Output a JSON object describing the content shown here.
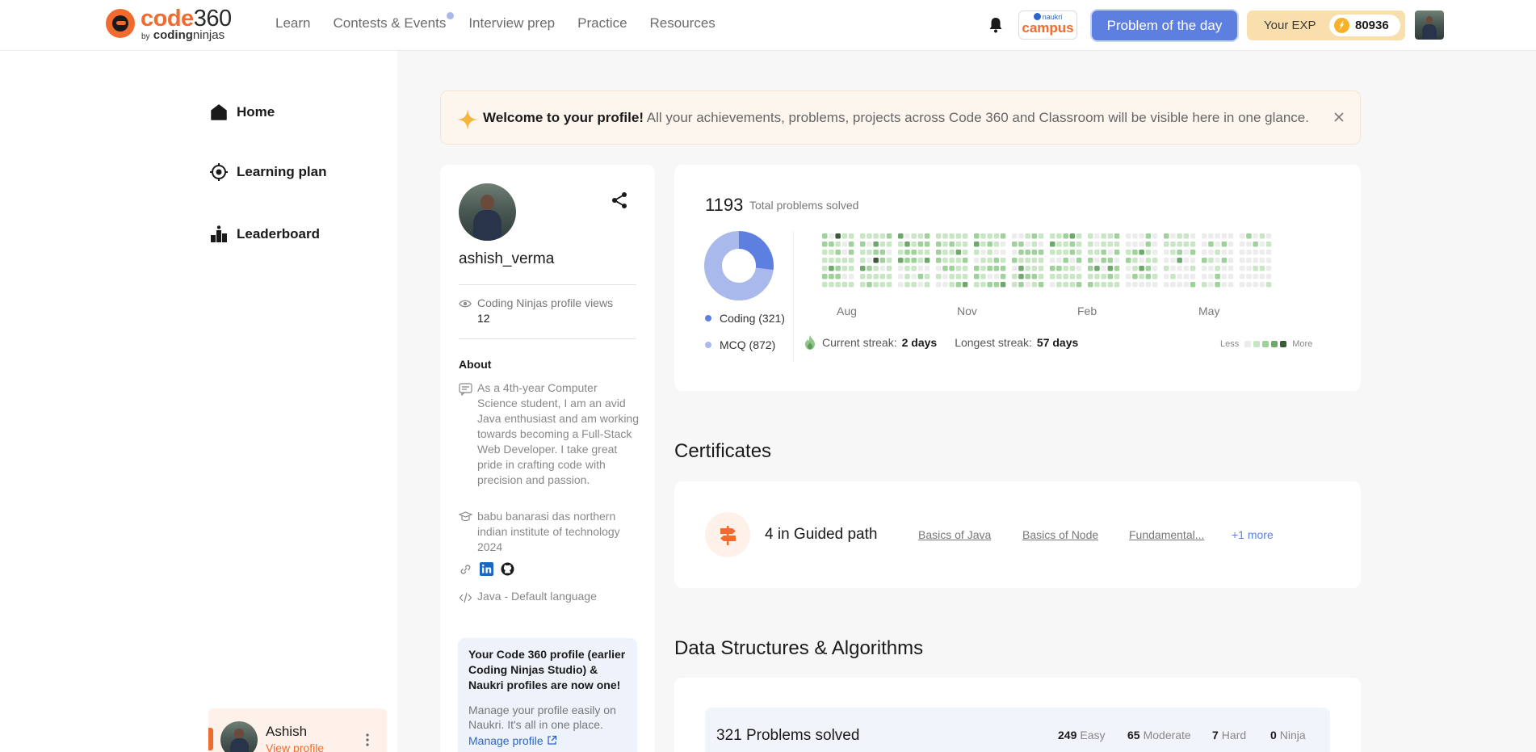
{
  "nav": {
    "logo_word": "code",
    "logo_num": "360",
    "logo_by": "by",
    "logo_brand_bold": "coding",
    "logo_brand_rest": "ninjas",
    "links": [
      "Learn",
      "Contests & Events",
      "Interview prep",
      "Practice",
      "Resources"
    ],
    "campus_top": "naukri",
    "campus_main": "campus",
    "potd_label": "Problem of the day",
    "exp_label": "Your EXP",
    "exp_value": "80936"
  },
  "sidebar": {
    "items": [
      {
        "label": "Home",
        "icon": "home-icon"
      },
      {
        "label": "Learning plan",
        "icon": "target-icon"
      },
      {
        "label": "Leaderboard",
        "icon": "leaderboard-icon"
      }
    ],
    "user_name": "Ashish",
    "user_link": "View profile"
  },
  "welcome": {
    "bold": "Welcome to your profile!",
    "text": " All your achievements, problems, projects across Code 360 and Classroom will be visible here in one glance."
  },
  "profile": {
    "username": "ashish_verma",
    "views_label": "Coding Ninjas profile views",
    "views_value": "12",
    "about_label": "About",
    "bio": "As a 4th-year Computer Science student, I am an avid Java enthusiast and am working towards becoming a Full-Stack Web Developer. I take great pride in crafting code with precision and passion.",
    "college": "babu banarasi das northern indian institute of technology 2024",
    "language": "Java - Default language",
    "notice_title": "Your Code 360 profile (earlier Coding Ninjas Studio) & Naukri profiles are now one!",
    "notice_desc": "Manage your profile easily on Naukri. It's all in one place.",
    "notice_link": "Manage profile"
  },
  "stats": {
    "total": "1193",
    "total_label": "Total problems solved",
    "coding_label": "Coding (321)",
    "mcq_label": "MCQ (872)",
    "coding_value": 321,
    "mcq_value": 872,
    "months": [
      "Aug",
      "Nov",
      "Feb",
      "May"
    ],
    "current_streak_label": "Current streak:",
    "current_streak": "2 days",
    "longest_streak_label": "Longest streak:",
    "longest_streak": "57 days",
    "legend_less": "Less",
    "legend_more": "More",
    "colors": {
      "coding": "#5d7fe0",
      "mcq": "#a9b9ec",
      "heat_levels": [
        "#ececec",
        "#c8e6c3",
        "#9fd19a",
        "#6fa86b",
        "#3c5a3a"
      ]
    }
  },
  "certificates": {
    "title": "Certificates",
    "summary": "4 in Guided path",
    "links": [
      "Basics of Java",
      "Basics of Node",
      "Fundamental..."
    ],
    "more": "+1 more"
  },
  "dsa": {
    "title": "Data Structures & Algorithms",
    "solved": "321 Problems solved",
    "easy_value": "249",
    "easy_label": "Easy",
    "moderate_value": "65",
    "moderate_label": "Moderate",
    "hard_value": "7",
    "hard_label": "Hard",
    "ninja_value": "0",
    "ninja_label": "Ninja"
  }
}
